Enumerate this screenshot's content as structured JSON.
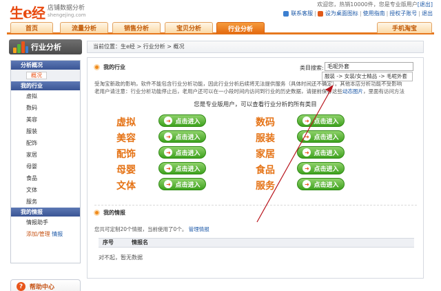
{
  "logo": {
    "main_a": "生",
    "main_b": "e",
    "main_c": "经",
    "sub1": "店铺数据分析",
    "sub2": "shengejing.com"
  },
  "top": {
    "welcome": "欢迎您，热销10000件，您是专业版用户",
    "welcome_link": "[退出]",
    "links": [
      "联系客服",
      "设为桌面图标",
      "使用指南",
      "授权子账号",
      "退出"
    ]
  },
  "nav": {
    "tabs": [
      "首页",
      "流量分析",
      "销售分析",
      "宝贝分析",
      "行业分析"
    ],
    "right_tab": "手机淘宝",
    "active_index": 4
  },
  "sidebar": {
    "title": "行业分析",
    "sections": [
      {
        "head": "分析概况",
        "items": [
          "概况"
        ]
      },
      {
        "head": "我的行业",
        "items": [
          "虚拟",
          "数码",
          "美容",
          "服装",
          "配饰",
          "家居",
          "母婴",
          "食品",
          "文体",
          "服务"
        ]
      },
      {
        "head": "我的情报",
        "items": [
          "情报助手"
        ]
      }
    ],
    "manage_a": "添加/管理",
    "manage_b": "情报",
    "help": "帮助中心"
  },
  "breadcrumb": "当前位置：生e经 > 行业分析 > 概况",
  "industry": {
    "title": "我的行业",
    "search_label": "类目搜索:",
    "search_value": "毛呢外套",
    "suggestion": "服装 -> 女装/女士精品 -> 毛呢外套",
    "notice1": "受淘宝新政的影响，软件不能包含行业分析功能，因此行业分析后续将无法提供服务（具体时间还不确定）。其他本店分析功能不受影响",
    "notice2_a": "老用户请注意：行业分析功能停止后，老用户还可以在一小段时间内访问到行业的历史数据，请提前保存这些",
    "notice2_link": "动态图片",
    "notice2_b": "，里面有访问方法",
    "pro_line": "您是专业版用户，可以查看行业分析的所有类目",
    "categories": [
      "虚拟",
      "数码",
      "美容",
      "服装",
      "配饰",
      "家居",
      "母婴",
      "食品",
      "文体",
      "服务"
    ],
    "enter_label": "点击进入"
  },
  "intel": {
    "title": "我的情报",
    "note": "您共可定制20个情报，当前使用了0个。",
    "note_link": "管理情报",
    "col1": "序号",
    "col2": "情报名",
    "empty": "对不起，暂无数据"
  },
  "colors": {
    "accent": "#e6781e",
    "category": "#e57316",
    "button": "#3ea21e",
    "link": "#1e5aa8",
    "arrow": "#b8141c"
  }
}
